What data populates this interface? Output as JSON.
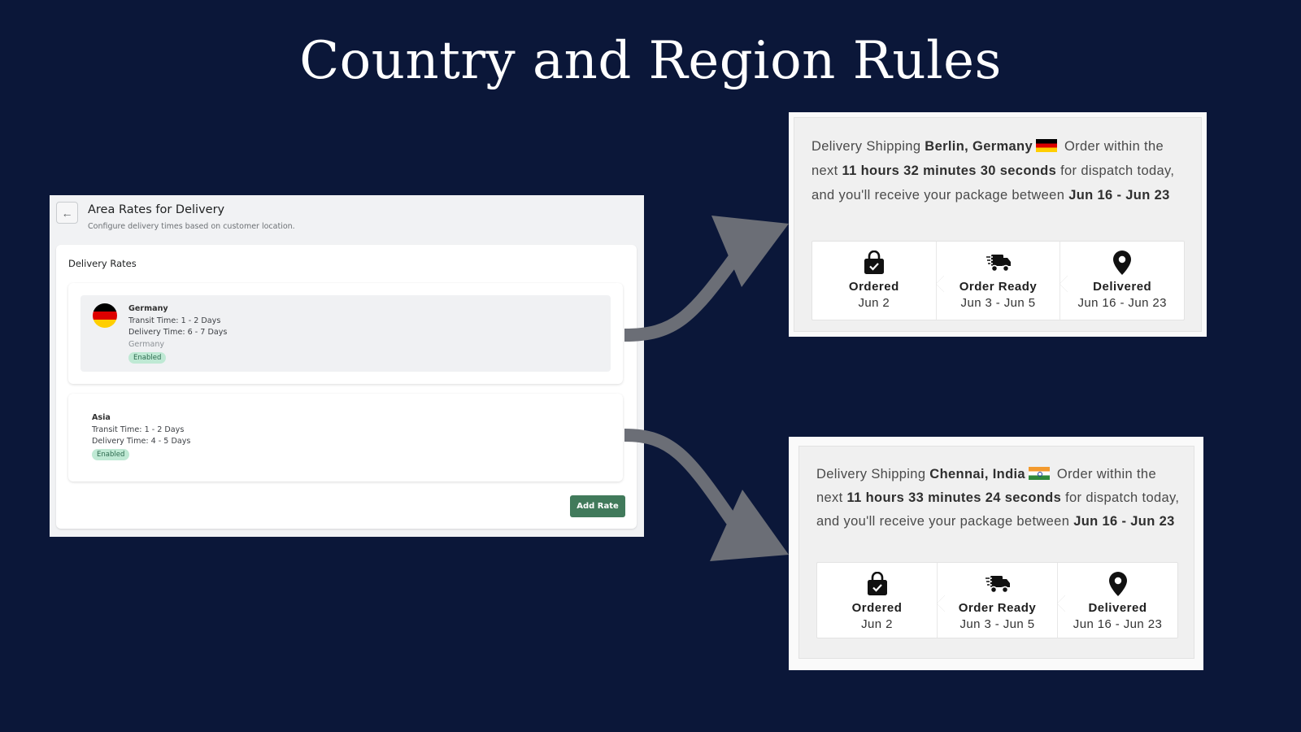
{
  "slide": {
    "title": "Country and Region Rules"
  },
  "admin": {
    "back_icon": "arrow-left-icon",
    "title": "Area Rates for Delivery",
    "subtitle": "Configure delivery times based on customer location.",
    "section_title": "Delivery Rates",
    "rates": [
      {
        "name": "Germany",
        "flag": "germany-flag",
        "transit": "Transit Time: 1 - 2 Days",
        "delivery": "Delivery Time: 6 - 7 Days",
        "region": "Germany",
        "status": "Enabled"
      },
      {
        "name": "Asia",
        "transit": "Transit Time: 1 - 2 Days",
        "delivery": "Delivery Time: 4 - 5 Days",
        "status": "Enabled"
      }
    ],
    "add_button": "Add Rate",
    "colors": {
      "button": "#417a5b",
      "badge_bg": "#bfe9d4",
      "badge_text": "#2d6a4f"
    }
  },
  "widgets": [
    {
      "prefix": "Delivery Shipping ",
      "location": "Berlin, Germany",
      "flag": "germany-flag",
      "mid1": " Order within the next ",
      "countdown": "11 hours 32 minutes 30 seconds",
      "mid2": " for dispatch today, and you'll receive your package between ",
      "range": "Jun 16 - Jun 23",
      "steps": [
        {
          "icon": "shopping-bag-check-icon",
          "title": "Ordered",
          "date": "Jun 2"
        },
        {
          "icon": "fast-truck-icon",
          "title": "Order Ready",
          "date": "Jun 3 - Jun 5"
        },
        {
          "icon": "map-pin-icon",
          "title": "Delivered",
          "date": "Jun 16 - Jun 23"
        }
      ]
    },
    {
      "prefix": "Delivery Shipping ",
      "location": "Chennai, India",
      "flag": "india-flag",
      "mid1": " Order within the next ",
      "countdown": "11 hours 33 minutes 24 seconds",
      "mid2": " for dispatch today, and you'll receive your package between ",
      "range": "Jun 16 - Jun 23",
      "steps": [
        {
          "icon": "shopping-bag-check-icon",
          "title": "Ordered",
          "date": "Jun 2"
        },
        {
          "icon": "fast-truck-icon",
          "title": "Order Ready",
          "date": "Jun 3 - Jun 5"
        },
        {
          "icon": "map-pin-icon",
          "title": "Delivered",
          "date": "Jun 16 - Jun 23"
        }
      ]
    }
  ],
  "colors": {
    "background": "#0b1739",
    "arrow": "#6b6e76"
  }
}
